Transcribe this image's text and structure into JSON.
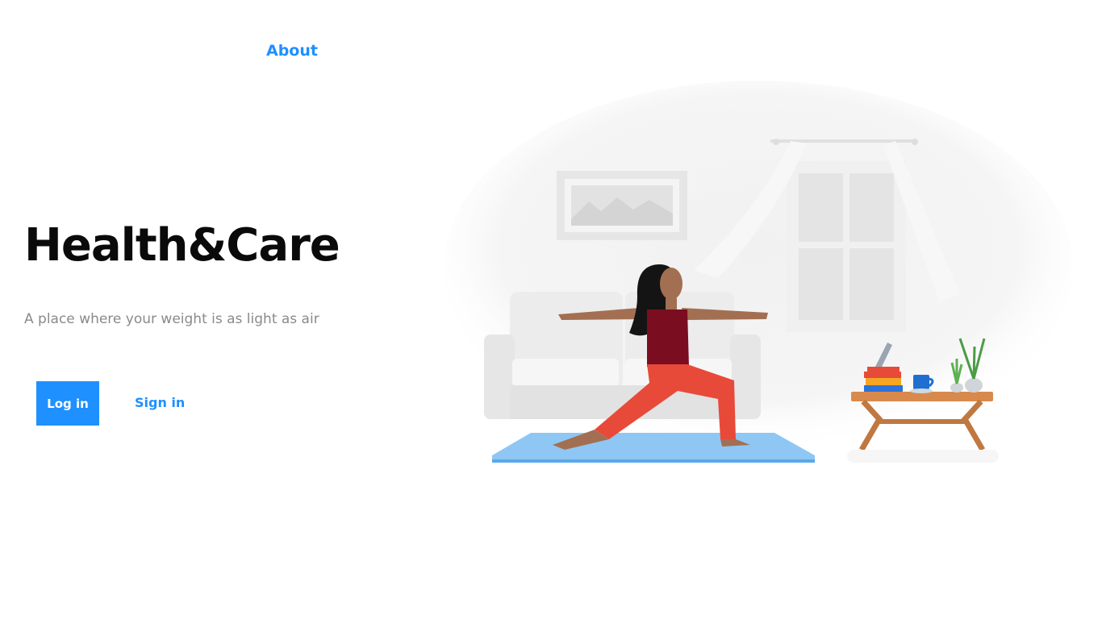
{
  "nav": {
    "about_label": "About"
  },
  "hero": {
    "title": "Health&Care",
    "subtitle": "A place where your weight is as light as air"
  },
  "actions": {
    "login_label": "Log in",
    "signin_label": "Sign in"
  },
  "colors": {
    "accent": "#1e90ff",
    "title": "#0a0a0a",
    "subtitle": "#8a8a8a"
  },
  "illustration": {
    "icon": "yoga-living-room-illustration"
  }
}
